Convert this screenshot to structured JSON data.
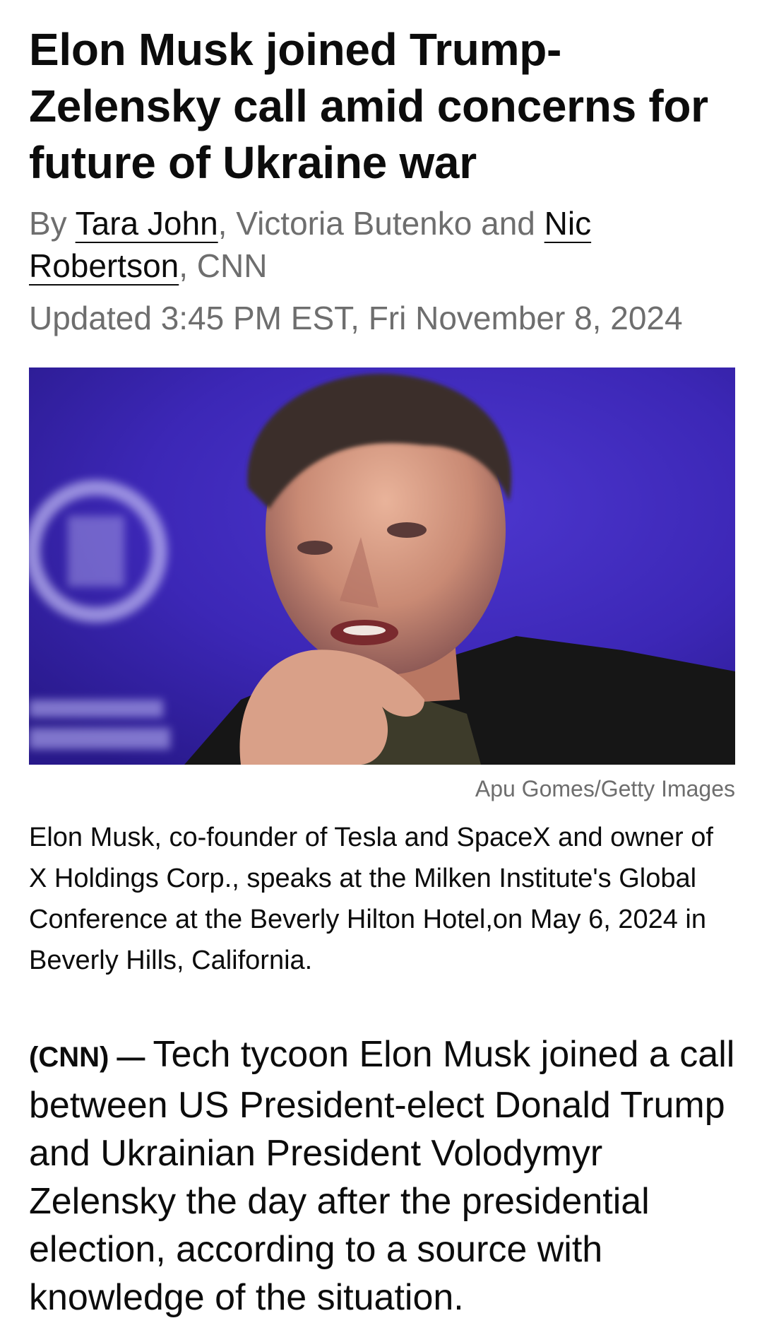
{
  "article": {
    "headline": "Elon Musk joined Trump-Zelensky call amid concerns for future of Ukraine war",
    "byline": {
      "prefix": "By ",
      "author1": "Tara John",
      "sep1": ", Victoria Butenko and ",
      "author3": "Nic Robertson",
      "suffix": ", CNN"
    },
    "timestamp": "Updated 3:45 PM EST, Fri November 8, 2024",
    "image": {
      "credit": "Apu Gomes/Getty Images",
      "caption": "Elon Musk, co-founder of Tesla and SpaceX and owner of X Holdings Corp., speaks at the Milken Institute's Global Conference at the Beverly Hilton Hotel,on May 6, 2024 in Beverly Hills, California."
    },
    "body": {
      "dateline": "(CNN) — ",
      "text": "Tech tycoon Elon Musk joined a call between US President-elect Donald Trump and Ukrainian President Volodymyr Zelensky the day after the presidential election, according to a source with knowledge of the situation."
    }
  },
  "colors": {
    "text": "#0c0c0c",
    "muted": "#6e6e6e",
    "photo_background": "#3b24b4"
  }
}
